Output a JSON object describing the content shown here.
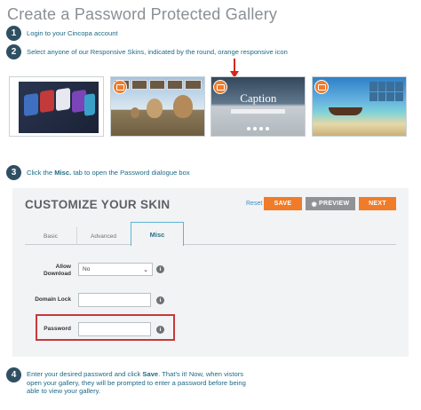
{
  "title": "Create a Password Protected Gallery",
  "steps": [
    {
      "num": "1",
      "text": "Login to your Cincopa account"
    },
    {
      "num": "2",
      "text": "Select anyone of our Responsive Skins, indicated by the round, orange responsive icon"
    },
    {
      "num": "3",
      "text_pre": "Click the ",
      "text_bold": "Misc.",
      "text_post": " tab to open the Password dialogue box"
    },
    {
      "num": "4",
      "text_pre": "Enter your desired password and click ",
      "text_bold": "Save",
      "text_post": ". That's it! Now, when vistors open your gallery, they will be prompted to enter a password before being able to view your gallery."
    }
  ],
  "skins": [
    {
      "name": "skin-1"
    },
    {
      "name": "skin-2"
    },
    {
      "name": "skin-3",
      "caption": "Caption"
    },
    {
      "name": "skin-4"
    }
  ],
  "dialog": {
    "title": "CUSTOMIZE YOUR SKIN",
    "reset": "Reset",
    "save": "SAVE",
    "preview": "PREVIEW",
    "next": "NEXT",
    "tabs": [
      "Basic",
      "Advanced",
      "Misc"
    ],
    "active_tab": "Misc",
    "fields": {
      "allow_download_label": "Allow Download",
      "allow_download_value": "No",
      "domain_lock_label": "Domain Lock",
      "password_label": "Password"
    }
  },
  "colors": {
    "accent_orange": "#f07c2a",
    "step_text": "#1d6a86",
    "highlight_red": "#c6393a",
    "arrow_red": "#d8261f"
  }
}
